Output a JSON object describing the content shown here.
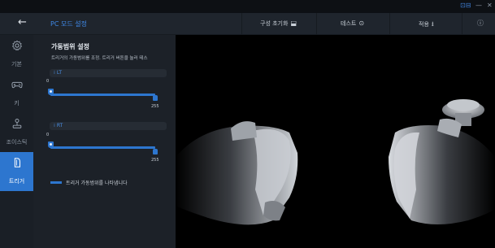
{
  "window": {
    "accent_glyph": "⊡⊟",
    "minimize": "—",
    "close": "✕"
  },
  "header": {
    "back_icon": "←",
    "title": "PC 모드 설정",
    "reset_label": "구성 초기화",
    "reset_icon": "⬓",
    "test_label": "테스트",
    "test_icon": "⊙",
    "apply_label": "적용",
    "apply_icon": "⭳",
    "info_icon": "ⓘ"
  },
  "nav": {
    "items": [
      {
        "label": "기본",
        "icon": "gear-icon"
      },
      {
        "label": "키",
        "icon": "gamepad-icon"
      },
      {
        "label": "조이스틱",
        "icon": "joystick-icon"
      },
      {
        "label": "트리거",
        "icon": "trigger-icon",
        "active": true
      }
    ]
  },
  "panel": {
    "title": "가동범위 설정",
    "description": "트리거의 가동범위를 조정. 트리거 버튼을 눌러 테스",
    "lt": {
      "label": "LT",
      "min_label": "0",
      "max_label": "255",
      "min": 0,
      "max": 255
    },
    "rt": {
      "label": "RT",
      "min_label": "0",
      "max_label": "255",
      "min": 0,
      "max": 255
    },
    "legend": "트리거 가동범위를 나타냅니다"
  },
  "colors": {
    "accent": "#2d76cf",
    "title_blue": "#3f88e6",
    "panel_bg": "#1c2128",
    "nav_bg": "#1a1f26",
    "header_bg": "#1f252d"
  }
}
